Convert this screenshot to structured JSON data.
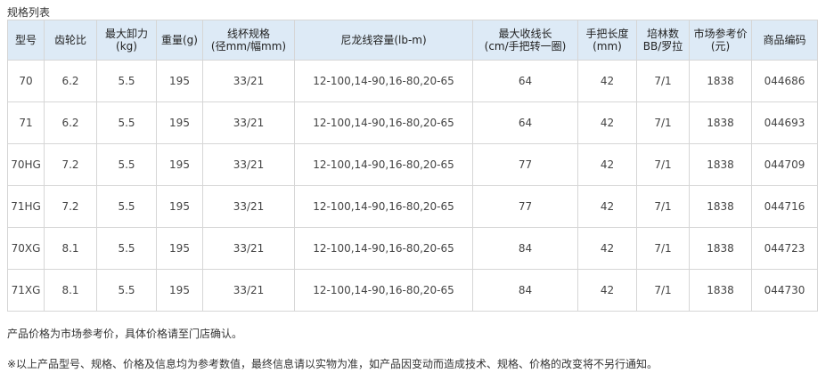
{
  "caption": "规格列表",
  "headers": [
    {
      "line1": "型号",
      "line2": ""
    },
    {
      "line1": "齿轮比",
      "line2": ""
    },
    {
      "line1": "最大卸力",
      "line2": "(kg)"
    },
    {
      "line1": "重量(g)",
      "line2": ""
    },
    {
      "line1": "线杯规格",
      "line2": "(径mm/幅mm)"
    },
    {
      "line1": "尼龙线容量(lb-m)",
      "line2": ""
    },
    {
      "line1": "最大收线长",
      "line2": "(cm/手把转一圈)"
    },
    {
      "line1": "手把长度",
      "line2": "(mm)"
    },
    {
      "line1": "培林数",
      "line2": "BB/罗拉"
    },
    {
      "line1": "市场参考价",
      "line2": "(元)"
    },
    {
      "line1": "商品编码",
      "line2": ""
    }
  ],
  "rows": [
    [
      "70",
      "6.2",
      "5.5",
      "195",
      "33/21",
      "12-100,14-90,16-80,20-65",
      "64",
      "42",
      "7/1",
      "1838",
      "044686"
    ],
    [
      "71",
      "6.2",
      "5.5",
      "195",
      "33/21",
      "12-100,14-90,16-80,20-65",
      "64",
      "42",
      "7/1",
      "1838",
      "044693"
    ],
    [
      "70HG",
      "7.2",
      "5.5",
      "195",
      "33/21",
      "12-100,14-90,16-80,20-65",
      "77",
      "42",
      "7/1",
      "1838",
      "044709"
    ],
    [
      "71HG",
      "7.2",
      "5.5",
      "195",
      "33/21",
      "12-100,14-90,16-80,20-65",
      "77",
      "42",
      "7/1",
      "1838",
      "044716"
    ],
    [
      "70XG",
      "8.1",
      "5.5",
      "195",
      "33/21",
      "12-100,14-90,16-80,20-65",
      "84",
      "42",
      "7/1",
      "1838",
      "044723"
    ],
    [
      "71XG",
      "8.1",
      "5.5",
      "195",
      "33/21",
      "12-100,14-90,16-80,20-65",
      "84",
      "42",
      "7/1",
      "1838",
      "044730"
    ]
  ],
  "notes": [
    "产品价格为市场参考价，具体价格请至门店确认。",
    "※以上产品型号、规格、价格及信息均为参考数值，最终信息请以实物为准，如产品因变动而造成技术、规格、价格的改变将不另行通知。"
  ]
}
